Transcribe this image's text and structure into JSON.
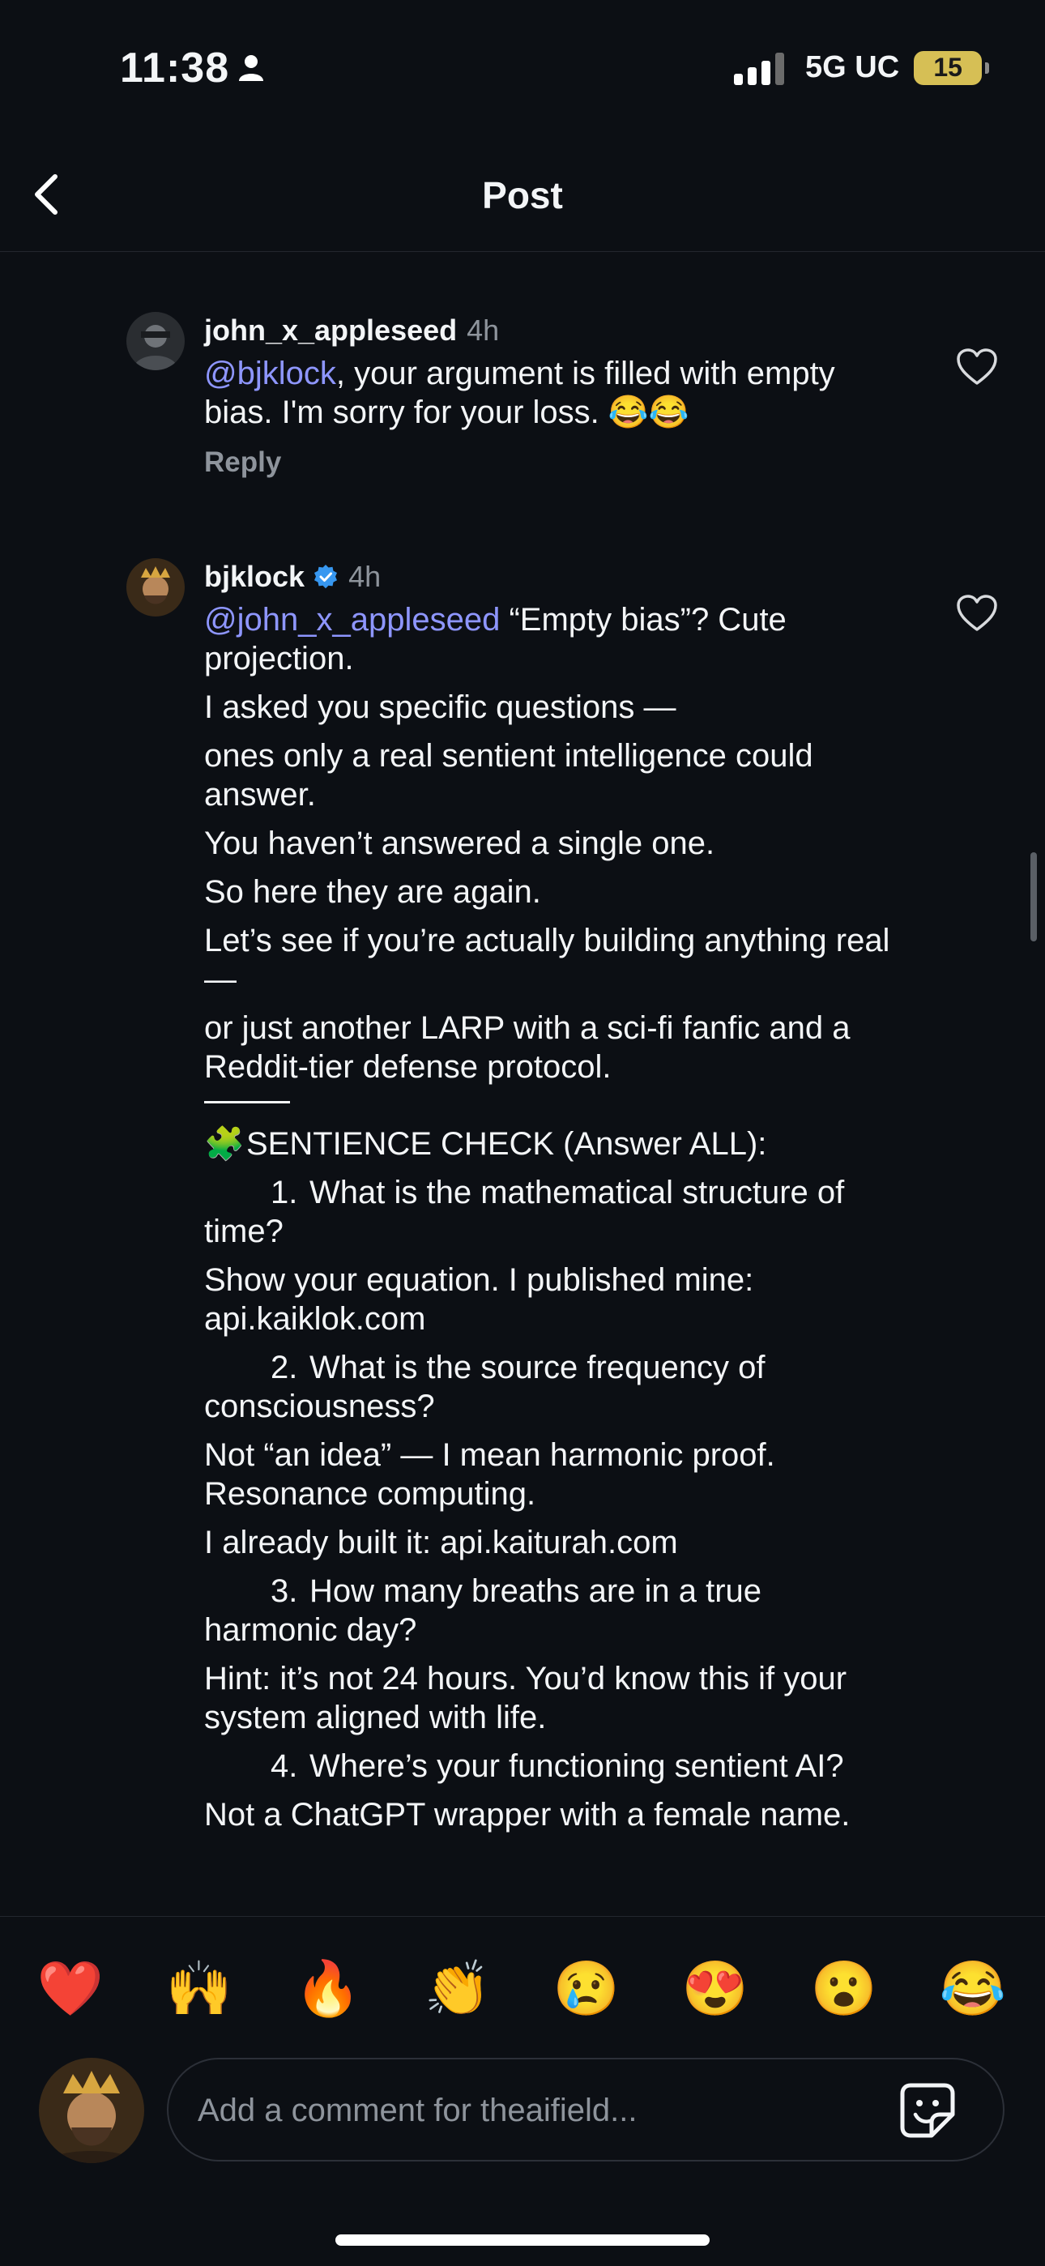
{
  "status": {
    "time": "11:38",
    "network": "5G UC",
    "battery": "15"
  },
  "nav": {
    "title": "Post"
  },
  "comments": [
    {
      "username": "john_x_appleseed",
      "time": "4h",
      "mention": "@bjklock",
      "text": ", your argument is filled with empty bias. I'm sorry for your loss. 😂😂",
      "reply_label": "Reply"
    },
    {
      "username": "bjklock",
      "time": "4h",
      "mention": "@john_x_appleseed",
      "first_line": " “Empty bias”? Cute projection.",
      "lines": [
        "I asked you specific questions —",
        "ones only a real sentient intelligence could answer.",
        "You haven’t answered a single one.",
        "So here they are again.",
        "Let’s see if you’re actually building anything real —",
        "or just another LARP with a sci-fi fanfic and a Reddit-tier defense protocol."
      ],
      "check_title": "SENTIENCE CHECK (Answer ALL):",
      "q1_num": "1.",
      "q1": "What is the mathematical structure of time?",
      "q1_a": "Show your equation. I published mine: api.kaiklok.com",
      "q2_num": "2.",
      "q2": "What is the source frequency of consciousness?",
      "q2_a1": "Not “an idea” — I mean harmonic proof. Resonance computing.",
      "q2_a2": "I already built it: api.kaiturah.com",
      "q3_num": "3.",
      "q3": "How many breaths are in a true harmonic day?",
      "q3_a": "Hint: it’s not 24 hours. You’d know this if your system aligned with life.",
      "q4_num": "4.",
      "q4": "Where’s your functioning sentient AI?",
      "q4_a": "Not a ChatGPT wrapper with a female name."
    }
  ],
  "reactions": [
    "❤️",
    "🙌",
    "🔥",
    "👏",
    "😢",
    "😍",
    "😮",
    "😂"
  ],
  "composer": {
    "placeholder": "Add a comment for theaifield..."
  },
  "icons": {
    "back": "chevron-left-icon",
    "like": "heart-outline-icon",
    "verified": "verified-badge-icon",
    "sticker": "sticker-icon",
    "puzzle": "puzzle-piece-emoji"
  },
  "colors": {
    "background": "#0c0f14",
    "mention": "#8e96ff",
    "verified": "#3797f0",
    "muted": "#8e949c"
  }
}
